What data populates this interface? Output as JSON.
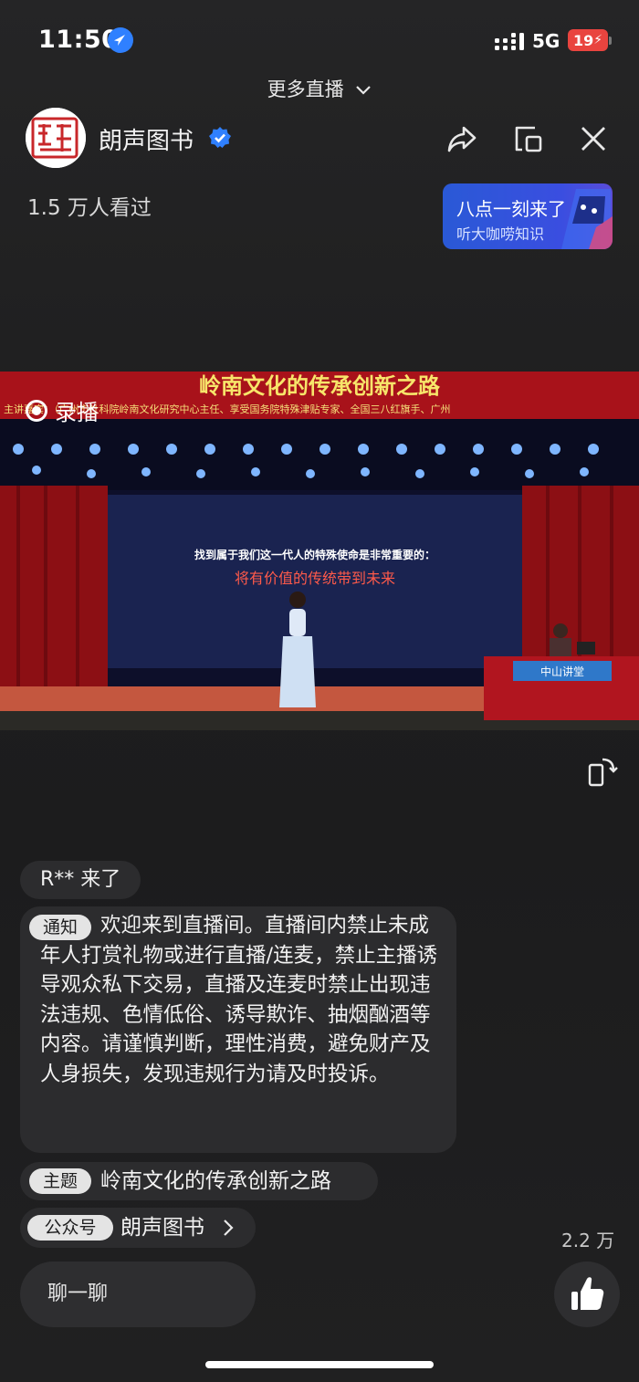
{
  "status_bar": {
    "time": "11:50",
    "network": "5G",
    "battery": "19"
  },
  "top": {
    "more_live": "更多直播"
  },
  "header": {
    "channel_name": "朗声图书",
    "viewers": "1.5 万人看过"
  },
  "promo": {
    "title": "八点一刻来了",
    "subtitle": "听大咖唠知识"
  },
  "video": {
    "badge": "录播",
    "banner_title": "岭南文化的传承创新之路",
    "banner_sub": "主讲嘉宾：（广州市社科院岭南文化研究中心主任、享受国务院特殊津贴专家、全国三八红旗手、广州",
    "screen_line1": "找到属于我们这一代人的特殊使命是非常重要的：",
    "screen_line2": "将有价值的传统带到未来",
    "desk_sign": "中山讲堂"
  },
  "chat": {
    "joined_msg": "R** 来了",
    "notice_tag": "通知",
    "notice_text": "欢迎来到直播间。直播间内禁止未成年人打赏礼物或进行直播/连麦，禁止主播诱导观众私下交易，直播及连麦时禁止出现违法违规、色情低俗、诱导欺诈、抽烟酗酒等内容。请谨慎判断，理性消费，避免财产及人身损失，发现违规行为请及时投诉。",
    "topic_tag": "主题",
    "topic_text": "岭南文化的传承创新之路",
    "official_tag": "公众号",
    "official_name": "朗声图书"
  },
  "bottom": {
    "input_placeholder": "聊一聊",
    "like_count": "2.2 万"
  },
  "colors": {
    "background": "#1e1e1f",
    "promo": "#2a59d6",
    "verified": "#2f80ff",
    "battery": "#e9443f",
    "curtain": "#8c0f14"
  }
}
